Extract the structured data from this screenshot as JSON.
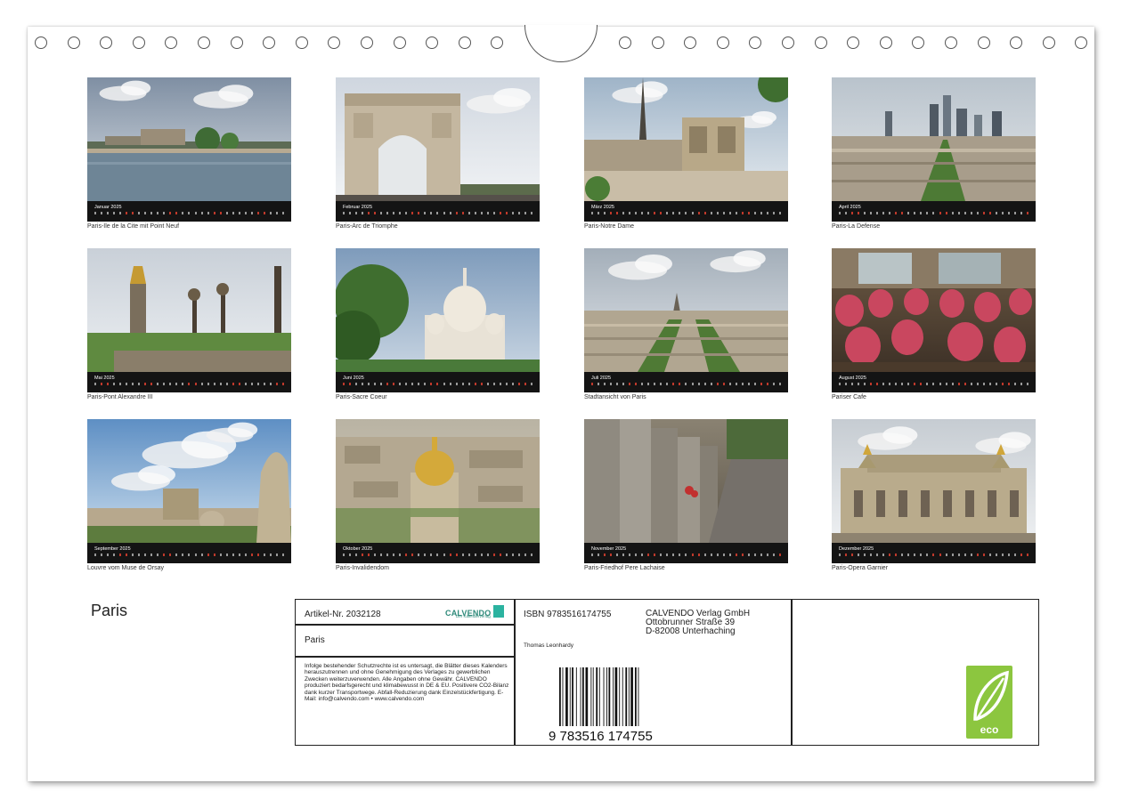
{
  "calendar_title": "Paris",
  "months": [
    {
      "month": "Januar 2025",
      "caption": "Paris-Ile de la Cite mit Point Neuf",
      "scene": "river-bridge"
    },
    {
      "month": "Februar 2025",
      "caption": "Paris-Arc de Triomphe",
      "scene": "arch"
    },
    {
      "month": "März 2025",
      "caption": "Paris-Notre Dame",
      "scene": "cathedral"
    },
    {
      "month": "April 2025",
      "caption": "Paris-La Defense",
      "scene": "skyline"
    },
    {
      "month": "Mai 2025",
      "caption": "Paris-Pont Alexandre III",
      "scene": "lamps"
    },
    {
      "month": "Juni 2025",
      "caption": "Paris-Sacre Coeur",
      "scene": "basilica"
    },
    {
      "month": "Juli 2025",
      "caption": "Stadtansicht von Paris",
      "scene": "cityview"
    },
    {
      "month": "August 2025",
      "caption": "Pariser Cafe",
      "scene": "cafe"
    },
    {
      "month": "September 2025",
      "caption": "Louvre vom Muse de Orsay",
      "scene": "louvre"
    },
    {
      "month": "Oktober 2025",
      "caption": "Paris-Invalidendom",
      "scene": "dome"
    },
    {
      "month": "November 2025",
      "caption": "Paris-Friedhof Pere Lachaise",
      "scene": "cemetery"
    },
    {
      "month": "Dezember 2025",
      "caption": "Paris-Opera Garnier",
      "scene": "opera"
    }
  ],
  "info": {
    "article": "Artikel-Nr. 2032128",
    "title": "Paris",
    "logo_word": "CALVENDO",
    "logo_sub": "Der Kalenderverlag",
    "legal_text": "Infolge bestehender Schutzrechte ist es untersagt, die Blätter dieses Kalenders herauszutrennen und ohne Genehmigung des Verlages zu gewerblichen Zwecken weiterzuverwenden. Alle Angaben ohne Gewähr. CALVENDO produziert bedarfsgerecht und klimabewusst in DE & EU. Positivere CO2-Bilanz dank kurzer Transportwege. Abfall-Reduzierung dank Einzelstückfertigung. E-Mail: info@calvendo.com • www.calvendo.com",
    "isbn": "ISBN 9783516174755",
    "publisher_line1": "CALVENDO Verlag GmbH",
    "publisher_line2": "Ottobrunner Straße 39",
    "publisher_line3": "D-82008 Unterhaching",
    "author": "Thomas Leonhardy",
    "barcode_digits": "9 783516 174755",
    "eco_label": "eco"
  },
  "colors": {
    "strip": "#141414",
    "weekend": "#c0392b",
    "eco": "#8cc63f",
    "calvendo": "#2e8a7a"
  }
}
